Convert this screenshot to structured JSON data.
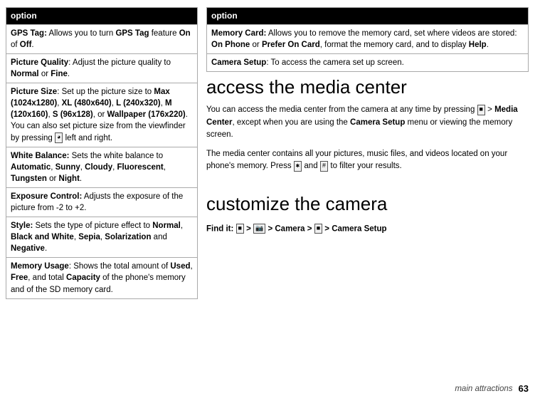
{
  "left_table": {
    "header": "option",
    "rows": [
      {
        "label": "GPS Tag:",
        "label_bold": true,
        "text": " Allows you to turn ",
        "inline": [
          {
            "text": "GPS Tag",
            "bold": true
          }
        ],
        "rest": " feature ",
        "inline2": [
          {
            "text": "On",
            "bold": true
          }
        ],
        "rest2": " of ",
        "inline3": [
          {
            "text": "Off",
            "bold": true
          }
        ],
        "rest3": ".",
        "full": "GPS Tag: Allows you to turn GPS Tag feature On of Off."
      },
      {
        "full": "Picture Quality: Adjust the picture quality to Normal or Fine."
      },
      {
        "full": "Picture Size: Set up the picture size to Max (1024x1280), XL (480x640), L (240x320), M (120x160), S (96x128), or Wallpaper (176x220). You can also set picture size from the viewfinder by pressing left and right."
      },
      {
        "full": "White Balance: Sets the white balance to Automatic, Sunny, Cloudy, Fluorescent, Tungsten or Night."
      },
      {
        "full": "Exposure Control: Adjusts the exposure of the picture from -2 to +2."
      },
      {
        "full": "Style: Sets the type of picture effect to Normal, Black and White, Sepia, Solarization and Negative."
      },
      {
        "full": "Memory Usage: Shows the total amount of Used, Free, and total Capacity of the phone's memory and of the SD memory card."
      }
    ]
  },
  "right_table": {
    "header": "option",
    "rows": [
      {
        "full": "Memory Card: Allows you to remove the memory card, set where videos are stored: On Phone or Prefer On Card, format the memory card, and to display Help."
      },
      {
        "full": "Camera Setup: To access the camera set up screen."
      }
    ]
  },
  "sections": [
    {
      "id": "access-media-center",
      "title": "access the media center",
      "paragraphs": [
        "You can access the media center from the camera at any time by pressing ■ > Media Center, except when you are using the Camera Setup menu or viewing the memory screen.",
        "The media center contains all your pictures, music files, and videos located on your phone’s memory. Press * and # to filter your results."
      ]
    },
    {
      "id": "customize-camera",
      "title": "customize the camera",
      "find_it": "Find it:",
      "find_it_path": "■ > 📷 > Camera > ■ > Camera Setup"
    }
  ],
  "footer": {
    "label": "main attractions",
    "page": "63"
  }
}
